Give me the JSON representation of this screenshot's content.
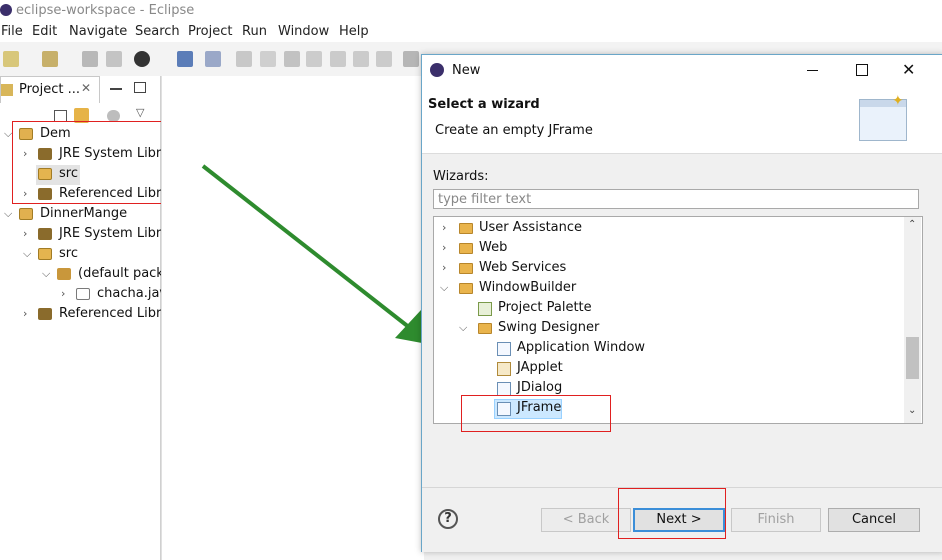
{
  "window": {
    "title": "eclipse-workspace - Eclipse"
  },
  "menu": [
    "File",
    "Edit",
    "Navigate",
    "Search",
    "Project",
    "Run",
    "Window",
    "Help"
  ],
  "explorer": {
    "tab_label": "Project ...",
    "tree": [
      {
        "label": "Dem",
        "depth": 0,
        "expanded": true,
        "icon": "project-icon"
      },
      {
        "label": "JRE System Libra",
        "depth": 1,
        "expanded": false,
        "icon": "library-icon"
      },
      {
        "label": "src",
        "depth": 1,
        "expanded": null,
        "icon": "source-folder-icon",
        "selected": true
      },
      {
        "label": "Referenced Libra",
        "depth": 1,
        "expanded": false,
        "icon": "library-icon"
      },
      {
        "label": "DinnerMange",
        "depth": 0,
        "expanded": true,
        "icon": "project-icon"
      },
      {
        "label": "JRE System Libra",
        "depth": 1,
        "expanded": false,
        "icon": "library-icon"
      },
      {
        "label": "src",
        "depth": 1,
        "expanded": true,
        "icon": "source-folder-icon"
      },
      {
        "label": "(default packa",
        "depth": 2,
        "expanded": true,
        "icon": "package-icon"
      },
      {
        "label": "chacha.jav",
        "depth": 3,
        "expanded": false,
        "icon": "java-file-icon"
      },
      {
        "label": "Referenced Libra",
        "depth": 1,
        "expanded": false,
        "icon": "library-icon"
      }
    ]
  },
  "dialog": {
    "title": "New",
    "heading": "Select a wizard",
    "description": "Create an empty JFrame",
    "wizards_label": "Wizards:",
    "filter_placeholder": "type filter text",
    "tree": [
      {
        "label": "User Assistance",
        "depth": 0,
        "expanded": false,
        "icon": "folder-icon"
      },
      {
        "label": "Web",
        "depth": 0,
        "expanded": false,
        "icon": "folder-icon"
      },
      {
        "label": "Web Services",
        "depth": 0,
        "expanded": false,
        "icon": "folder-icon"
      },
      {
        "label": "WindowBuilder",
        "depth": 0,
        "expanded": true,
        "icon": "folder-icon"
      },
      {
        "label": "Project Palette",
        "depth": 1,
        "expanded": null,
        "icon": "palette-icon"
      },
      {
        "label": "Swing Designer",
        "depth": 1,
        "expanded": true,
        "icon": "folder-icon"
      },
      {
        "label": "Application Window",
        "depth": 2,
        "expanded": null,
        "icon": "window-wizard-icon"
      },
      {
        "label": "JApplet",
        "depth": 2,
        "expanded": null,
        "icon": "applet-wizard-icon"
      },
      {
        "label": "JDialog",
        "depth": 2,
        "expanded": null,
        "icon": "dialog-wizard-icon"
      },
      {
        "label": "JFrame",
        "depth": 2,
        "expanded": null,
        "icon": "frame-wizard-icon",
        "selected": true
      }
    ],
    "buttons": {
      "back": "< Back",
      "next": "Next >",
      "finish": "Finish",
      "cancel": "Cancel"
    }
  },
  "colors": {
    "accent": "#3b8ed8",
    "annotation": "#e02020",
    "arrow": "#2e8b2e",
    "selection": "#cce8ff"
  }
}
